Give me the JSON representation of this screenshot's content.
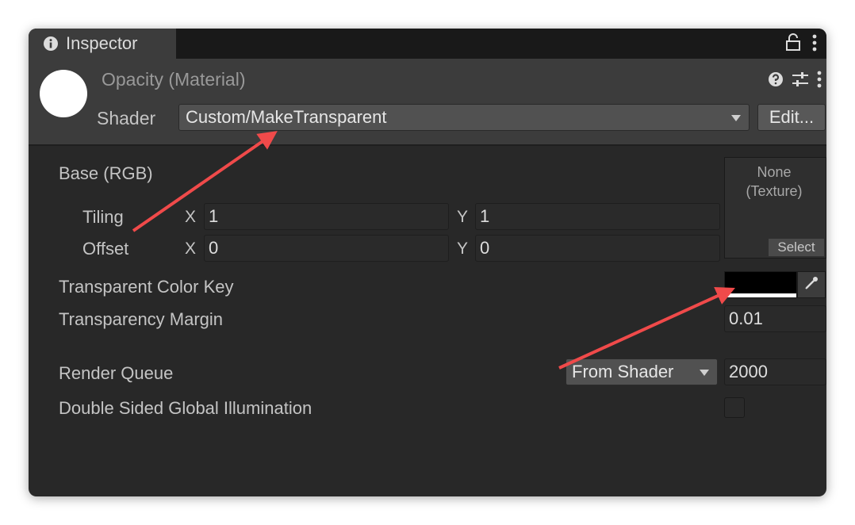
{
  "tab": {
    "title": "Inspector",
    "icon": "info-icon"
  },
  "tab_icons": [
    "lock-icon",
    "kebab-menu-icon"
  ],
  "material": {
    "title": "Opacity (Material)"
  },
  "header_icons": [
    "help-icon",
    "sliders-icon",
    "kebab-menu-icon"
  ],
  "shader": {
    "label": "Shader",
    "value": "Custom/MakeTransparent",
    "edit_label": "Edit..."
  },
  "properties": {
    "base_label": "Base (RGB)",
    "tiling": {
      "label": "Tiling",
      "x_axis": "X",
      "x": "1",
      "y_axis": "Y",
      "y": "1"
    },
    "offset": {
      "label": "Offset",
      "x_axis": "X",
      "x": "0",
      "y_axis": "Y",
      "y": "0"
    },
    "texture": {
      "line1": "None",
      "line2": "(Texture)",
      "select_label": "Select"
    },
    "transparent_color_key": {
      "label": "Transparent Color Key",
      "color": "#000000",
      "alpha_color": "#ffffff"
    },
    "transparency_margin": {
      "label": "Transparency Margin",
      "value": "0.01"
    },
    "render_queue": {
      "label": "Render Queue",
      "mode": "From Shader",
      "value": "2000"
    },
    "double_sided_gi": {
      "label": "Double Sided Global Illumination",
      "checked": false
    }
  },
  "annotation_color": "#f04a4a"
}
